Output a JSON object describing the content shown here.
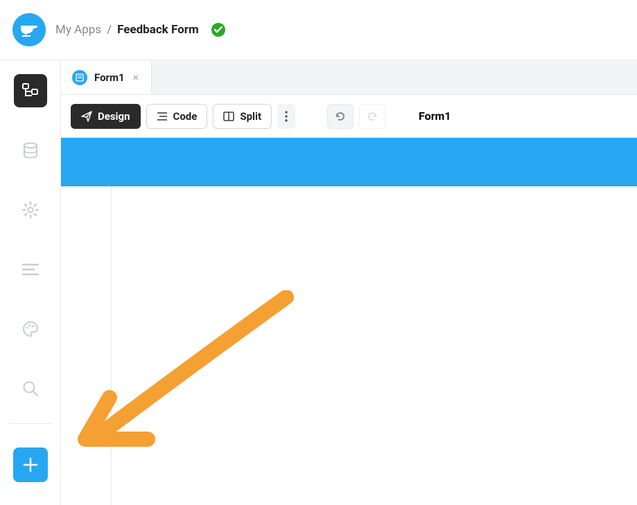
{
  "breadcrumb": {
    "parent": "My Apps",
    "separator": "/",
    "current": "Feedback Form"
  },
  "tabs": [
    {
      "label": "Form1"
    }
  ],
  "toolbar": {
    "design_label": "Design",
    "code_label": "Code",
    "split_label": "Split",
    "form_name": "Form1"
  },
  "sidebar": {
    "items": [
      {
        "name": "app-browser",
        "active": true
      },
      {
        "name": "database"
      },
      {
        "name": "settings"
      },
      {
        "name": "text-lines"
      },
      {
        "name": "theme"
      },
      {
        "name": "search"
      }
    ]
  }
}
